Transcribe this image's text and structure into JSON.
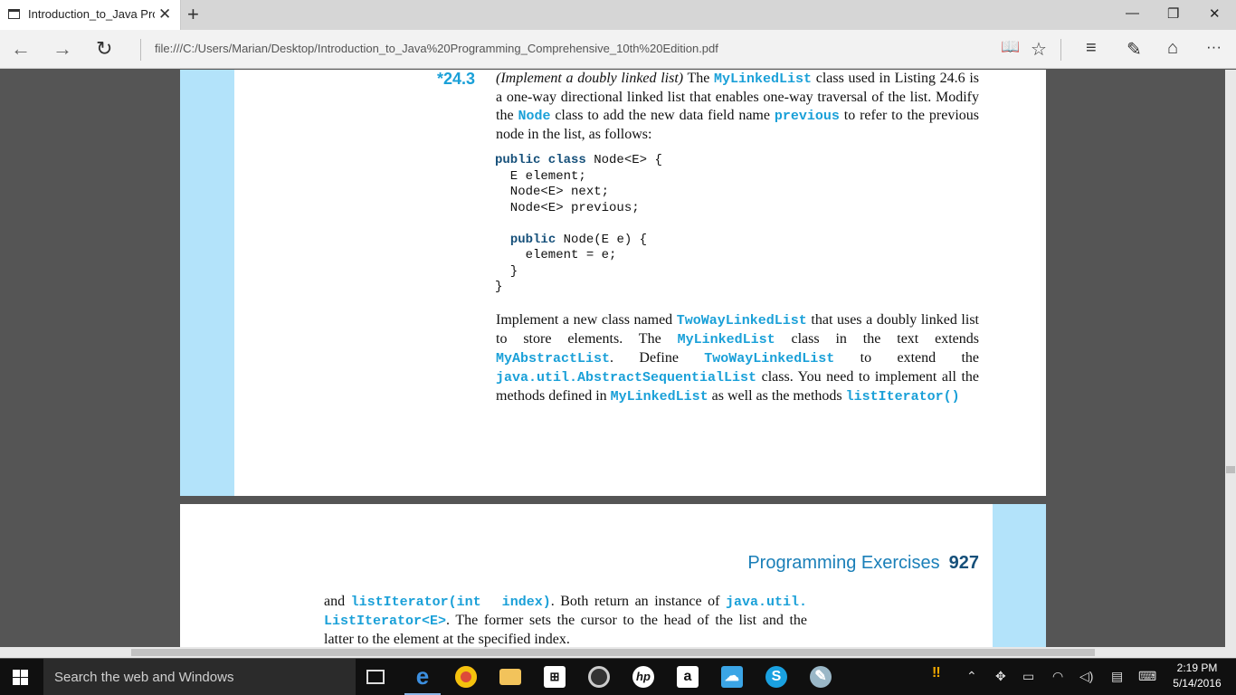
{
  "browser": {
    "tab_title": "Introduction_to_Java Pro",
    "tab_close": "✕",
    "new_tab": "+",
    "url": "file:///C:/Users/Marian/Desktop/Introduction_to_Java%20Programming_Comprehensive_10th%20Edition.pdf",
    "min_glyph": "—",
    "restore_glyph": "❐",
    "close_glyph": "✕",
    "back_glyph": "←",
    "forward_glyph": "→",
    "refresh_glyph": "↻",
    "reading_glyph": "📖",
    "favorite_glyph": "☆",
    "hub_glyph": "≡",
    "note_glyph": "✎",
    "share_glyph": "⌂",
    "more_glyph": "···"
  },
  "document": {
    "exercise_number": "*24.3",
    "intro": {
      "t1": "(Implement a doubly linked list)",
      "t2": " The ",
      "c1": "MyLinkedList",
      "t3": " class used in Listing 24.6 is a one-way directional linked list that enables one-way traversal of the list. Modify the ",
      "c2": "Node",
      "t4": " class to add the new data field name ",
      "c3": "previous",
      "t5": " to refer to the previous node in the list, as follows:"
    },
    "code": {
      "l1_kw": "public class",
      "l1_rest": " Node<E> {",
      "l2": "  E element;",
      "l3": "  Node<E> next;",
      "l4": "  Node<E> previous;",
      "l6_indent": "  ",
      "l6_kw": "public",
      "l6_rest": " Node(E e) {",
      "l7": "    element = e;",
      "l8": "  }",
      "l9": "}"
    },
    "body": {
      "t1": "Implement a new class named ",
      "c1": "TwoWayLinkedList",
      "t2": " that uses a doubly linked list to store elements. The ",
      "c2": "MyLinkedList",
      "t3": " class in the text extends ",
      "c3": "MyAbstractList",
      "t4": ". Define ",
      "c4": "TwoWayLinkedList",
      "t5": " to extend the ",
      "c5": "java.util.AbstractSequentialList",
      "t6": " class. You need to implement all the methods defined in ",
      "c6": "MyLinkedList",
      "t7": " as well as the methods ",
      "c7": "listIterator()"
    },
    "page2": {
      "header_title": "Programming Exercises",
      "page_number": "927",
      "t1": "and ",
      "c1": "listIterator(int  index)",
      "t2": ". Both return an instance of ",
      "c2": "java.util.",
      "c3": "ListIterator<E>",
      "t3": ". The former sets the cursor to the head of the list and the latter to the element at the specified index."
    }
  },
  "taskbar": {
    "search_placeholder": "Search the web and Windows",
    "time": "2:19 PM",
    "date": "5/14/2016",
    "apps": [
      "task-view",
      "edge",
      "chrome",
      "file-explorer",
      "store",
      "camera",
      "hp",
      "amazon",
      "onedrive",
      "skype",
      "paint"
    ]
  },
  "colors": {
    "accent_cyan": "#1aa0d8",
    "code_keyword": "#16507a",
    "page_band": "#b3e3fa",
    "viewer_bg": "#555555"
  }
}
